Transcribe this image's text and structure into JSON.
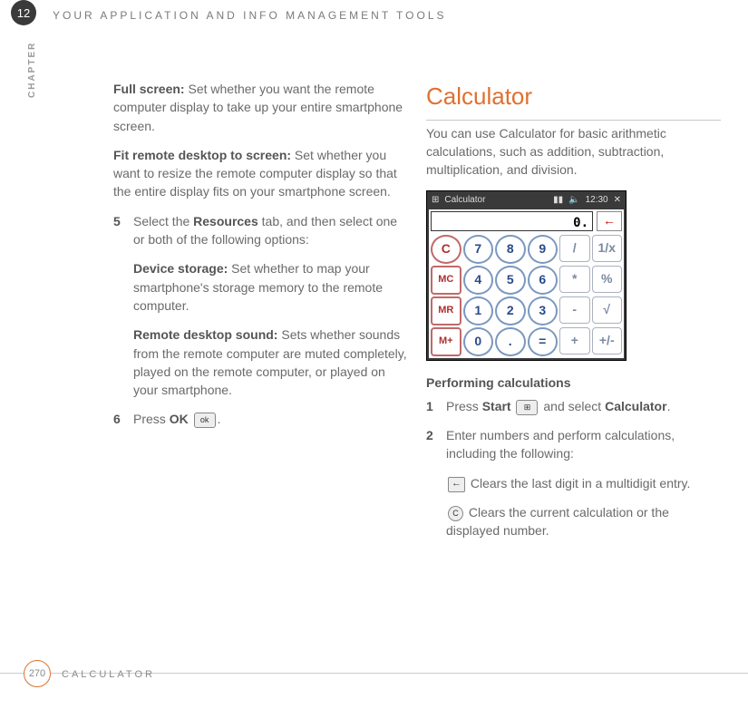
{
  "chapterNumber": "12",
  "chapterLabel": "CHAPTER",
  "headerTitle": "YOUR APPLICATION AND INFO MANAGEMENT TOOLS",
  "left": {
    "para1": {
      "bold": "Full screen:",
      "rest": " Set whether you want the remote computer display to take up your entire smartphone screen."
    },
    "para2": {
      "bold": "Fit remote desktop to screen:",
      "rest": " Set whether you want to resize the remote computer display so that the entire display fits on your smartphone screen."
    },
    "step5": {
      "num": "5",
      "body": {
        "pre": "Select the ",
        "bold": "Resources",
        "post": " tab, and then select one or both of the following options:"
      }
    },
    "para3": {
      "bold": "Device storage:",
      "rest": " Set whether to map your smartphone's storage memory to the remote computer."
    },
    "para4": {
      "bold": "Remote desktop sound:",
      "rest": " Sets whether sounds from the remote computer are muted completely, played on the remote computer, or played on your smartphone."
    },
    "step6": {
      "num": "6",
      "pre": "Press ",
      "bold": "OK",
      "iconText": "ok",
      "post": "."
    }
  },
  "right": {
    "heading": "Calculator",
    "intro": "You can use Calculator for basic arithmetic calculations, such as addition, subtraction, multiplication, and division.",
    "calc": {
      "titleText": "Calculator",
      "time": "12:30",
      "close": "✕",
      "displayValue": "0.",
      "backGlyph": "←",
      "rows": [
        [
          "C",
          "7",
          "8",
          "9",
          "/",
          "1/x"
        ],
        [
          "MC",
          "4",
          "5",
          "6",
          "*",
          "%"
        ],
        [
          "MR",
          "1",
          "2",
          "3",
          "-",
          "√"
        ],
        [
          "M+",
          "0",
          ".",
          "=",
          "+",
          "+/-"
        ]
      ]
    },
    "subhead": "Performing calculations",
    "step1": {
      "num": "1",
      "pre": "Press ",
      "bold1": "Start",
      "iconText": "⊞",
      "mid": " and select ",
      "bold2": "Calculator",
      "post": "."
    },
    "step2": {
      "num": "2",
      "line": "Enter numbers and perform calculations, including the following:"
    },
    "iconLine1": {
      "iconText": "←",
      "rest": " Clears the last digit in a multidigit entry."
    },
    "iconLine2": {
      "iconText": "C",
      "rest": " Clears the current calculation or the displayed number."
    }
  },
  "footer": {
    "page": "270",
    "section": "CALCULATOR"
  }
}
